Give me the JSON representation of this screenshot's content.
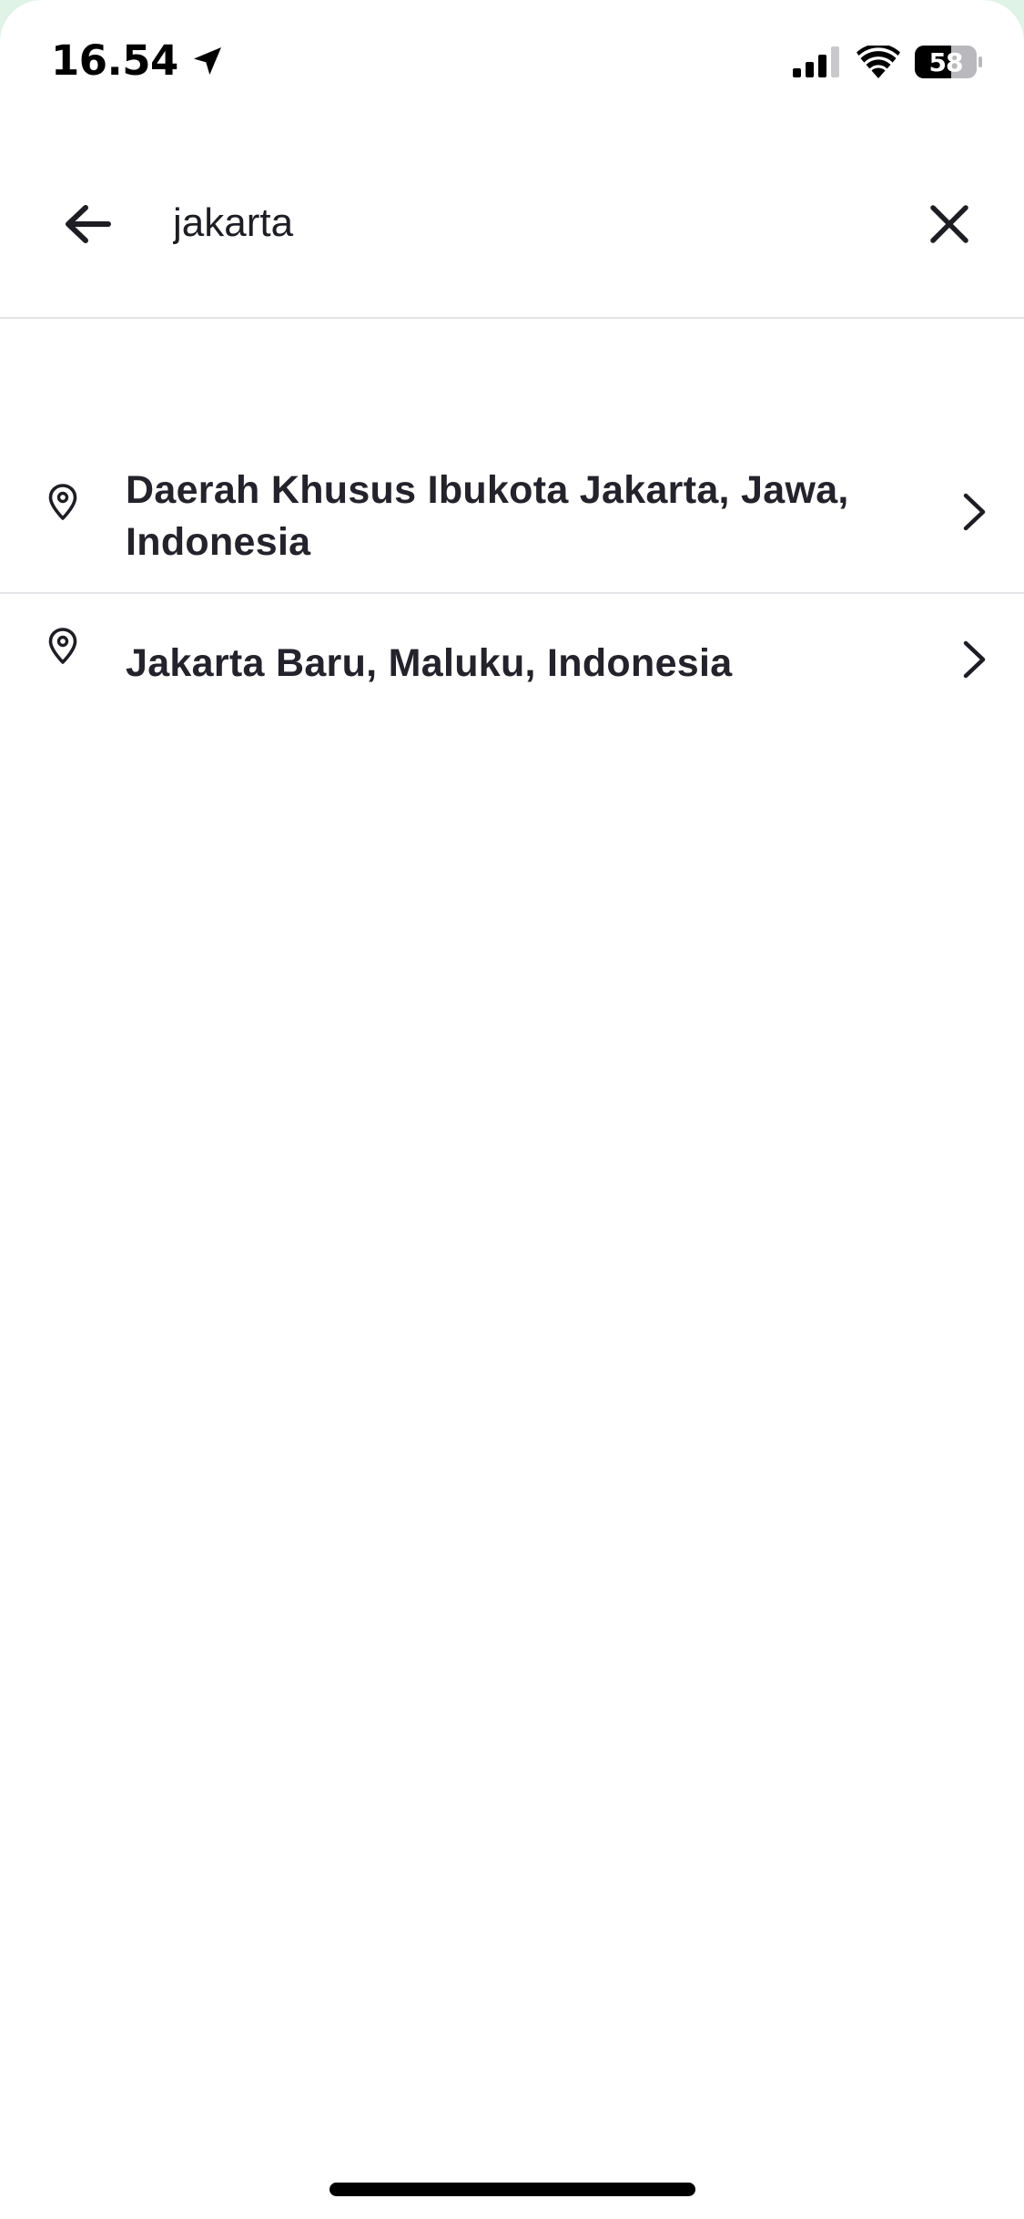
{
  "status_bar": {
    "time": "16.54",
    "battery_level": "58",
    "icons": [
      "location-arrow-icon",
      "signal-icon",
      "wifi-icon",
      "battery-icon"
    ]
  },
  "search": {
    "value": "jakarta",
    "placeholder": "",
    "icons": [
      "back-arrow-icon",
      "close-icon"
    ]
  },
  "results": [
    {
      "label": "Daerah Khusus Ibukota Jakarta, Jawa, Indonesia",
      "icon": "location-pin-icon"
    },
    {
      "label": "Jakarta Baru, Maluku, Indonesia",
      "icon": "location-pin-icon"
    }
  ],
  "colors": {
    "text": "#1f1d24",
    "divider": "#e4e4e8",
    "background": "#ffffff"
  }
}
